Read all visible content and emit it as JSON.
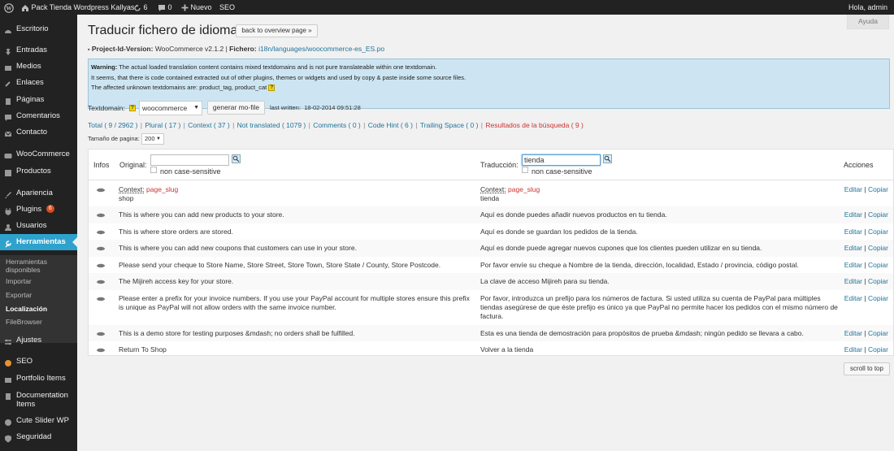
{
  "adminbar": {
    "site_name": "Pack Tienda Wordpress Kallyas",
    "updates_count": "6",
    "comments_count": "0",
    "new_label": "Nuevo",
    "seo_label": "SEO",
    "greeting": "Hola, admin"
  },
  "sidebar": {
    "items": [
      {
        "label": "Escritorio",
        "icon": "dashboard-icon"
      },
      {
        "label": "Entradas",
        "icon": "pin-icon"
      },
      {
        "label": "Medios",
        "icon": "media-icon"
      },
      {
        "label": "Enlaces",
        "icon": "link-icon"
      },
      {
        "label": "Páginas",
        "icon": "page-icon"
      },
      {
        "label": "Comentarios",
        "icon": "comment-icon"
      },
      {
        "label": "Contacto",
        "icon": "mail-icon"
      },
      {
        "label": "WooCommerce",
        "icon": "woo-icon"
      },
      {
        "label": "Productos",
        "icon": "product-icon"
      },
      {
        "label": "Apariencia",
        "icon": "brush-icon"
      },
      {
        "label": "Plugins",
        "icon": "plug-icon",
        "badge": "6"
      },
      {
        "label": "Usuarios",
        "icon": "user-icon"
      },
      {
        "label": "Herramientas",
        "icon": "wrench-icon"
      },
      {
        "label": "Ajustes",
        "icon": "settings-icon"
      },
      {
        "label": "SEO",
        "icon": "seo-icon"
      },
      {
        "label": "Portfolio Items",
        "icon": "portfolio-icon"
      },
      {
        "label": "Documentation Items",
        "icon": "doc-icon"
      },
      {
        "label": "Cute Slider WP",
        "icon": "slider-icon"
      },
      {
        "label": "Seguridad",
        "icon": "shield-icon"
      }
    ],
    "submenu": [
      {
        "label": "Herramientas disponibles"
      },
      {
        "label": "Importar"
      },
      {
        "label": "Exportar"
      },
      {
        "label": "Localización"
      },
      {
        "label": "FileBrowser"
      }
    ]
  },
  "main": {
    "help_label": "Ayuda",
    "title": "Traducir fichero de idioma",
    "back_button": "back to overview page »",
    "project_label": "Project-Id-Version:",
    "project_value": "WooCommerce v2.1.2",
    "file_label": "Fichero:",
    "file_value": "i18n/languages/woocommerce-es_ES.po",
    "warning": {
      "line1_label": "Warning:",
      "line1": "The actual loaded translation content contains mixed textdomains and is not pure translateable within one textdomain.",
      "line2": "It seems, that there is code contained extracted out of other plugins, themes or widgets and used by copy & paste inside some source files.",
      "line3": "The affected unknown textdomains are: product_tag, product_cat"
    },
    "textdomain_label": "Textdomain:",
    "textdomain_value": "woocommerce",
    "generate_button": "generar mo-file",
    "last_written_label": "last written:",
    "last_written_value": "18-02-2014 09:51:28",
    "filters": {
      "total": "Total ( 9 / 2962 )",
      "plural": "Plural ( 17 )",
      "context": "Context ( 37 )",
      "not_translated": "Not translated ( 1079 )",
      "comments": "Comments ( 0 )",
      "code_hint": "Code Hint ( 6 )",
      "trailing_space": "Trailing Space ( 0 )",
      "search_results": "Resultados de la búsqueda ( 9 )"
    },
    "page_size_label": "Tamaño de pagina:",
    "page_size_value": "200",
    "table": {
      "col_infos": "Infos",
      "col_original": "Original:",
      "col_translation": "Traducción:",
      "col_actions": "Acciones",
      "original_search_value": "",
      "translation_search_value": "tienda",
      "case_label": "non case-sensitive",
      "edit_label": "Editar",
      "copy_label": "Copiar",
      "context_label": "Context:",
      "rows": [
        {
          "context": "page_slug",
          "original": "shop",
          "translation": "tienda"
        },
        {
          "original": "This is where you can add new products to your store.",
          "translation": "Aquí es donde puedes añadir nuevos productos en tu tienda."
        },
        {
          "original": "This is where store orders are stored.",
          "translation": "Aquí es donde se guardan los pedidos de la tienda."
        },
        {
          "original": "This is where you can add new coupons that customers can use in your store.",
          "translation": "Aquí es donde puede agregar nuevos cupones que los clientes pueden utilizar en su tienda."
        },
        {
          "original": "Please send your cheque to Store Name, Store Street, Store Town, Store State / County, Store Postcode.",
          "translation": "Por favor envíe su cheque a Nombre de la tienda, dirección, localidad, Estado / provincia, código postal."
        },
        {
          "original": "The Mijireh access key for your store.",
          "translation": "La clave de acceso Mijireh para su tienda."
        },
        {
          "original": "Please enter a prefix for your invoice numbers. If you use your PayPal account for multiple stores ensure this prefix is unique as PayPal will not allow orders with the same invoice number.",
          "translation": "Por favor, introduzca un prefijo para los números de factura. Si usted utiliza su cuenta de PayPal para múltiples tiendas asegúrese de que éste prefijo es único ya que PayPal no permite hacer los pedidos con el mismo número de factura."
        },
        {
          "original": "This is a demo store for testing purposes &mdash; no orders shall be fulfilled.",
          "translation": "Esta es una tienda de demostración para propósitos de prueba &mdash; ningún pedido se llevara a cabo."
        },
        {
          "original": "Return To Shop",
          "translation": "Volver a la tienda"
        }
      ]
    },
    "scroll_top": "scroll to top"
  }
}
